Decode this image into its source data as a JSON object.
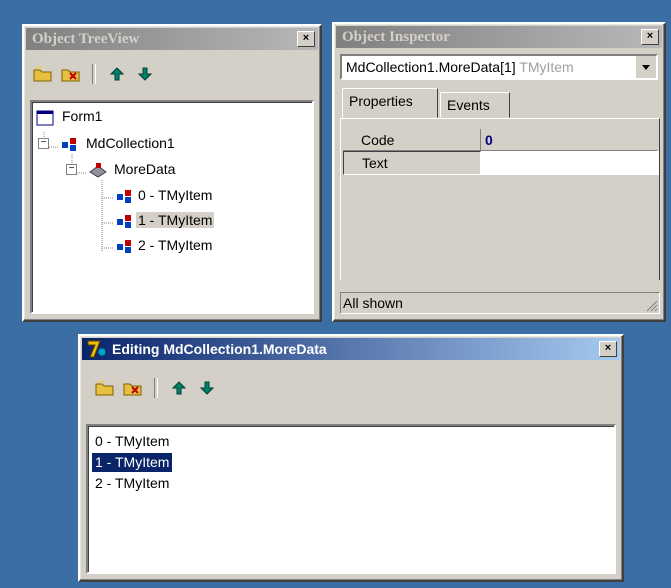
{
  "treeview": {
    "title": "Object TreeView",
    "close_label": "×",
    "nodes": {
      "form": "Form1",
      "collection": "MdCollection1",
      "moredata": "MoreData",
      "item0": "0 - TMyItem",
      "item1": "1 - TMyItem",
      "item2": "2 - TMyItem"
    },
    "expander_minus": "−"
  },
  "inspector": {
    "title": "Object Inspector",
    "close_label": "×",
    "selector_value": "MdCollection1.MoreData[1]",
    "selector_type": "TMyItem",
    "tabs": [
      "Properties",
      "Events"
    ],
    "rows": [
      {
        "name": "Code",
        "value": "0"
      },
      {
        "name": "Text",
        "value": ""
      }
    ],
    "status": "All shown"
  },
  "editor": {
    "title": "Editing MdCollection1.MoreData",
    "close_label": "×",
    "items": [
      "0 - TMyItem",
      "1 - TMyItem",
      "2 - TMyItem"
    ],
    "selected_index": 1
  },
  "colors": {
    "desktop": "#3a6ea5",
    "active_title": "#0a246a",
    "selection": "#0a246a"
  }
}
